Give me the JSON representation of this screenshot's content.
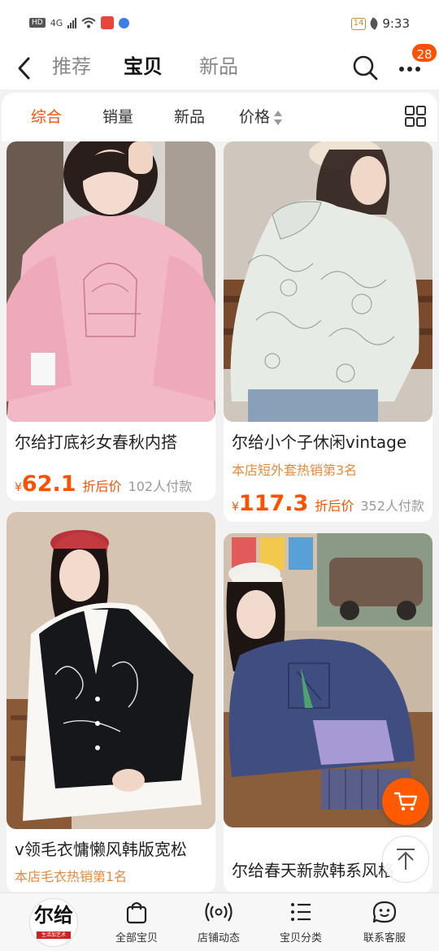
{
  "status_bar": {
    "hd": "HD",
    "network": "4G",
    "battery": "14",
    "time": "9:33"
  },
  "header": {
    "tabs": [
      "推荐",
      "宝贝",
      "新品"
    ],
    "active_tab": "宝贝",
    "notification_count": "28"
  },
  "filters": {
    "items": [
      "综合",
      "销量",
      "新品",
      "价格"
    ],
    "active": "综合"
  },
  "products": [
    {
      "title": "尔给打底衫女春秋内搭",
      "subtitle": "",
      "currency": "¥",
      "price": "62.1",
      "price_tag": "折后价",
      "paid": "102人付款",
      "image": "pink-sweatshirt-photo"
    },
    {
      "title": "尔给小个子休闲vintage",
      "subtitle": "本店短外套热销第3名",
      "currency": "¥",
      "price": "117.3",
      "price_tag": "折后价",
      "paid": "352人付款",
      "image": "white-hooded-jacket-photo"
    },
    {
      "title": "v领毛衣慵懒风韩版宽松",
      "subtitle": "本店毛衣热销第1名",
      "image": "black-vest-white-shirt-photo"
    },
    {
      "title": "尔给春天新款韩系风格",
      "subtitle": "",
      "image": "navy-sweatshirt-photo"
    }
  ],
  "bottom_nav": {
    "shop_logo_text": "尔给",
    "shop_logo_sub": "生活加艺术",
    "items": [
      "全部宝贝",
      "店铺动态",
      "宝贝分类",
      "联系客服"
    ]
  },
  "colors": {
    "accent": "#ff5000",
    "subtitle": "#e8893c"
  }
}
